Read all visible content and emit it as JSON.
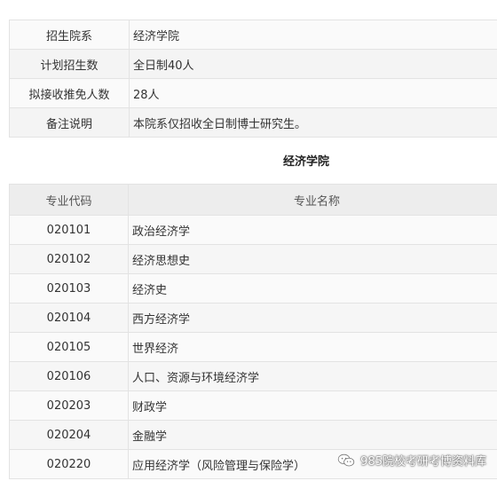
{
  "info": [
    {
      "label": "招生院系",
      "value": "经济学院"
    },
    {
      "label": "计划招生数",
      "value": "全日制40人"
    },
    {
      "label": "拟接收推免人数",
      "value": "28人"
    },
    {
      "label": "备注说明",
      "value": "本院系仅招收全日制博士研究生。"
    }
  ],
  "section_title": "经济学院",
  "majors": {
    "headers": {
      "code": "专业代码",
      "name": "专业名称"
    },
    "rows": [
      {
        "code": "020101",
        "name": "政治经济学"
      },
      {
        "code": "020102",
        "name": "经济思想史"
      },
      {
        "code": "020103",
        "name": "经济史"
      },
      {
        "code": "020104",
        "name": "西方经济学"
      },
      {
        "code": "020105",
        "name": "世界经济"
      },
      {
        "code": "020106",
        "name": "人口、资源与环境经济学"
      },
      {
        "code": "020203",
        "name": "财政学"
      },
      {
        "code": "020204",
        "name": "金融学"
      },
      {
        "code": "020220",
        "name": "应用经济学（风险管理与保险学）"
      }
    ]
  },
  "watermark": {
    "icon": "wechat-icon",
    "text": "985院校考研考博资料库"
  }
}
